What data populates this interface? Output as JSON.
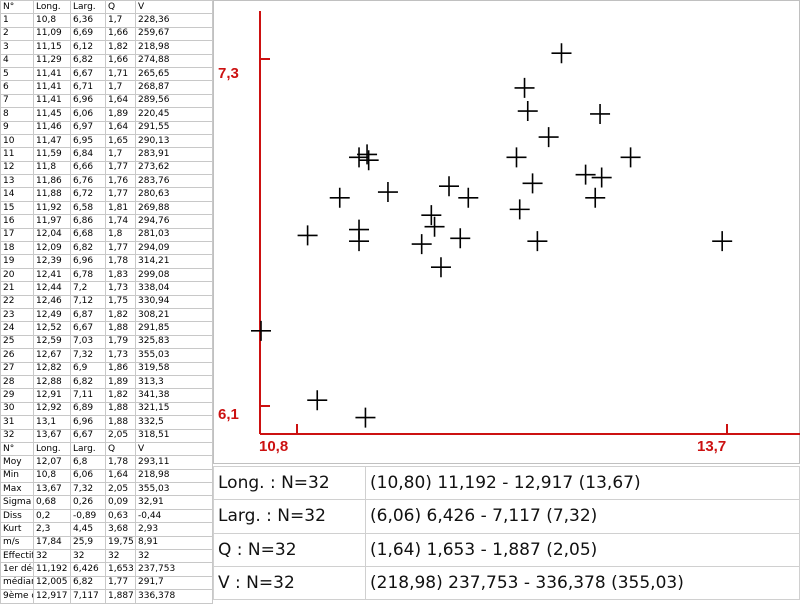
{
  "table": {
    "headers": [
      "N°",
      "Long.",
      "Larg.",
      "Q",
      "V"
    ],
    "rows": [
      [
        "1",
        "10,8",
        "6,36",
        "1,7",
        "228,36"
      ],
      [
        "2",
        "11,09",
        "6,69",
        "1,66",
        "259,67"
      ],
      [
        "3",
        "11,15",
        "6,12",
        "1,82",
        "218,98"
      ],
      [
        "4",
        "11,29",
        "6,82",
        "1,66",
        "274,88"
      ],
      [
        "5",
        "11,41",
        "6,67",
        "1,71",
        "265,65"
      ],
      [
        "6",
        "11,41",
        "6,71",
        "1,7",
        "268,87"
      ],
      [
        "7",
        "11,41",
        "6,96",
        "1,64",
        "289,56"
      ],
      [
        "8",
        "11,45",
        "6,06",
        "1,89",
        "220,45"
      ],
      [
        "9",
        "11,46",
        "6,97",
        "1,64",
        "291,55"
      ],
      [
        "10",
        "11,47",
        "6,95",
        "1,65",
        "290,13"
      ],
      [
        "11",
        "11,59",
        "6,84",
        "1,7",
        "283,91"
      ],
      [
        "12",
        "11,8",
        "6,66",
        "1,77",
        "273,62"
      ],
      [
        "13",
        "11,86",
        "6,76",
        "1,76",
        "283,76"
      ],
      [
        "14",
        "11,88",
        "6,72",
        "1,77",
        "280,63"
      ],
      [
        "15",
        "11,92",
        "6,58",
        "1,81",
        "269,88"
      ],
      [
        "16",
        "11,97",
        "6,86",
        "1,74",
        "294,76"
      ],
      [
        "17",
        "12,04",
        "6,68",
        "1,8",
        "281,03"
      ],
      [
        "18",
        "12,09",
        "6,82",
        "1,77",
        "294,09"
      ],
      [
        "19",
        "12,39",
        "6,96",
        "1,78",
        "314,21"
      ],
      [
        "20",
        "12,41",
        "6,78",
        "1,83",
        "299,08"
      ],
      [
        "21",
        "12,44",
        "7,2",
        "1,73",
        "338,04"
      ],
      [
        "22",
        "12,46",
        "7,12",
        "1,75",
        "330,94"
      ],
      [
        "23",
        "12,49",
        "6,87",
        "1,82",
        "308,21"
      ],
      [
        "24",
        "12,52",
        "6,67",
        "1,88",
        "291,85"
      ],
      [
        "25",
        "12,59",
        "7,03",
        "1,79",
        "325,83"
      ],
      [
        "26",
        "12,67",
        "7,32",
        "1,73",
        "355,03"
      ],
      [
        "27",
        "12,82",
        "6,9",
        "1,86",
        "319,58"
      ],
      [
        "28",
        "12,88",
        "6,82",
        "1,89",
        "313,3"
      ],
      [
        "29",
        "12,91",
        "7,11",
        "1,82",
        "341,38"
      ],
      [
        "30",
        "12,92",
        "6,89",
        "1,88",
        "321,15"
      ],
      [
        "31",
        "13,1",
        "6,96",
        "1,88",
        "332,5"
      ],
      [
        "32",
        "13,67",
        "6,67",
        "2,05",
        "318,51"
      ]
    ],
    "summary": [
      [
        "N°",
        "Long.",
        "Larg.",
        "Q",
        "V"
      ],
      [
        "Moy",
        "12,07",
        "6,8",
        "1,78",
        "293,11"
      ],
      [
        "Min",
        "10,8",
        "6,06",
        "1,64",
        "218,98"
      ],
      [
        "Max",
        "13,67",
        "7,32",
        "2,05",
        "355,03"
      ],
      [
        "Sigma",
        "0,68",
        "0,26",
        "0,09",
        "32,91"
      ],
      [
        "Diss",
        "0,2",
        "-0,89",
        "0,63",
        "-0,44"
      ],
      [
        "Kurt",
        "2,3",
        "4,45",
        "3,68",
        "2,93"
      ],
      [
        "m/s",
        "17,84",
        "25,9",
        "19,75",
        "8,91"
      ],
      [
        "Effectif =",
        "32",
        "32",
        "32",
        "32"
      ],
      [
        "1er décile",
        "11,192",
        "6,426",
        "1,653",
        "237,753"
      ],
      [
        "médiane",
        "12,005",
        "6,82",
        "1,77",
        "291,7"
      ],
      [
        "9ème décile",
        "12,917",
        "7,117",
        "1,887",
        "336,378"
      ]
    ]
  },
  "chart_data": {
    "type": "scatter",
    "x_label_min": "10,8",
    "x_label_max": "13,7",
    "y_label_min": "6,1",
    "y_label_max": "7,3",
    "xlim": [
      10.8,
      13.7
    ],
    "ylim": [
      6.1,
      7.3
    ],
    "marker": "plus",
    "points": [
      [
        10.8,
        6.36
      ],
      [
        11.09,
        6.69
      ],
      [
        11.15,
        6.12
      ],
      [
        11.29,
        6.82
      ],
      [
        11.41,
        6.67
      ],
      [
        11.41,
        6.71
      ],
      [
        11.41,
        6.96
      ],
      [
        11.45,
        6.06
      ],
      [
        11.46,
        6.97
      ],
      [
        11.47,
        6.95
      ],
      [
        11.59,
        6.84
      ],
      [
        11.8,
        6.66
      ],
      [
        11.86,
        6.76
      ],
      [
        11.88,
        6.72
      ],
      [
        11.92,
        6.58
      ],
      [
        11.97,
        6.86
      ],
      [
        12.04,
        6.68
      ],
      [
        12.09,
        6.82
      ],
      [
        12.39,
        6.96
      ],
      [
        12.41,
        6.78
      ],
      [
        12.44,
        7.2
      ],
      [
        12.46,
        7.12
      ],
      [
        12.49,
        6.87
      ],
      [
        12.52,
        6.67
      ],
      [
        12.59,
        7.03
      ],
      [
        12.67,
        7.32
      ],
      [
        12.82,
        6.9
      ],
      [
        12.88,
        6.82
      ],
      [
        12.91,
        7.11
      ],
      [
        12.92,
        6.89
      ],
      [
        13.1,
        6.96
      ],
      [
        13.67,
        6.67
      ]
    ],
    "colors": {
      "axes": "#cc1111",
      "markers": "#000000"
    }
  },
  "stats": [
    {
      "label": "Long.  : N=32",
      "range": "(10,80) 11,192 - 12,917 (13,67)"
    },
    {
      "label": "Larg. : N=32",
      "range": "(6,06) 6,426 - 7,117 (7,32)"
    },
    {
      "label": "Q       : N=32",
      "range": "(1,64) 1,653 - 1,887 (2,05)"
    },
    {
      "label": "V       : N=32",
      "range": "(218,98) 237,753 - 336,378 (355,03)"
    }
  ]
}
